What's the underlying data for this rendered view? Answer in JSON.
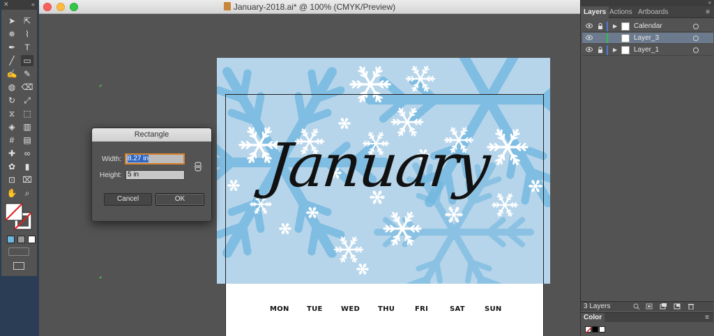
{
  "window": {
    "title": "January-2018.ai* @ 100% (CMYK/Preview)"
  },
  "artwork": {
    "heading": "January",
    "days": [
      "MON",
      "TUE",
      "WED",
      "THU",
      "FRI",
      "SAT",
      "SUN"
    ],
    "sky_color": "#b6d5ea",
    "flake_color": "#6fb6e0"
  },
  "dialog": {
    "title": "Rectangle",
    "width_label": "Width:",
    "width_value": "8.27 in",
    "height_label": "Height:",
    "height_value": "5 in",
    "cancel_label": "Cancel",
    "ok_label": "OK"
  },
  "layers_panel": {
    "tabs": [
      "Layers",
      "Actions",
      "Artboards"
    ],
    "active_tab": "Layers",
    "layers": [
      {
        "name": "Calendar",
        "color": "#4b7bd6",
        "locked": true,
        "expandable": true,
        "selected": false
      },
      {
        "name": "Layer_3",
        "color": "#2fc14b",
        "locked": false,
        "expandable": false,
        "selected": true
      },
      {
        "name": "Layer_1",
        "color": "#4b7bd6",
        "locked": true,
        "expandable": true,
        "selected": false
      }
    ],
    "footer_count": "3 Layers"
  },
  "color_panel": {
    "title": "Color"
  },
  "tools": [
    "selection-tool",
    "direct-selection-tool",
    "magic-wand-tool",
    "lasso-tool",
    "pen-tool",
    "type-tool",
    "line-tool",
    "rectangle-tool",
    "paintbrush-tool",
    "pencil-tool",
    "blob-brush-tool",
    "eraser-tool",
    "rotate-tool",
    "scale-tool",
    "width-tool",
    "free-transform-tool",
    "shape-builder-tool",
    "graph-tool",
    "mesh-tool",
    "gradient-tool",
    "eyedropper-tool",
    "blend-tool",
    "symbol-sprayer-tool",
    "column-graph-tool",
    "artboard-tool",
    "slice-tool",
    "hand-tool",
    "zoom-tool"
  ]
}
